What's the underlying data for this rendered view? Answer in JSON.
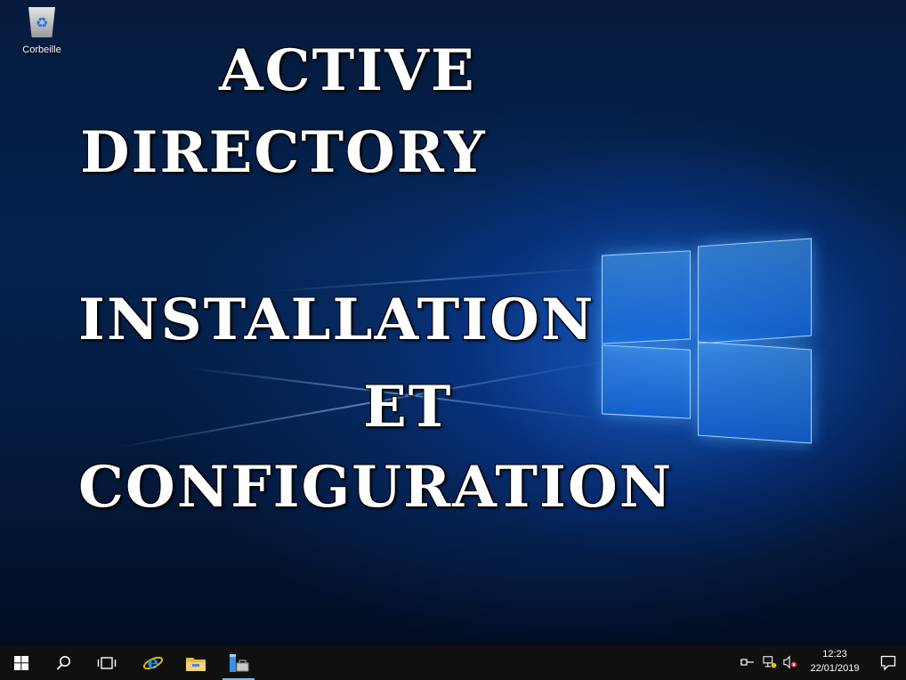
{
  "desktop": {
    "recycle_bin_label": "Corbeille",
    "title_lines": [
      "ACTIVE",
      "DIRECTORY",
      "INSTALLATION",
      "ET",
      "CONFIGURATION"
    ]
  },
  "taskbar": {
    "icons": [
      "windows-start-icon",
      "search-icon",
      "task-view-icon",
      "internet-explorer-icon",
      "file-explorer-icon",
      "server-manager-icon"
    ],
    "tray_icons": [
      "power-plug-icon",
      "network-icon",
      "volume-muted-icon"
    ],
    "clock": {
      "time": "12:23",
      "date": "22/01/2019"
    },
    "notification_icon": "action-center-icon"
  }
}
